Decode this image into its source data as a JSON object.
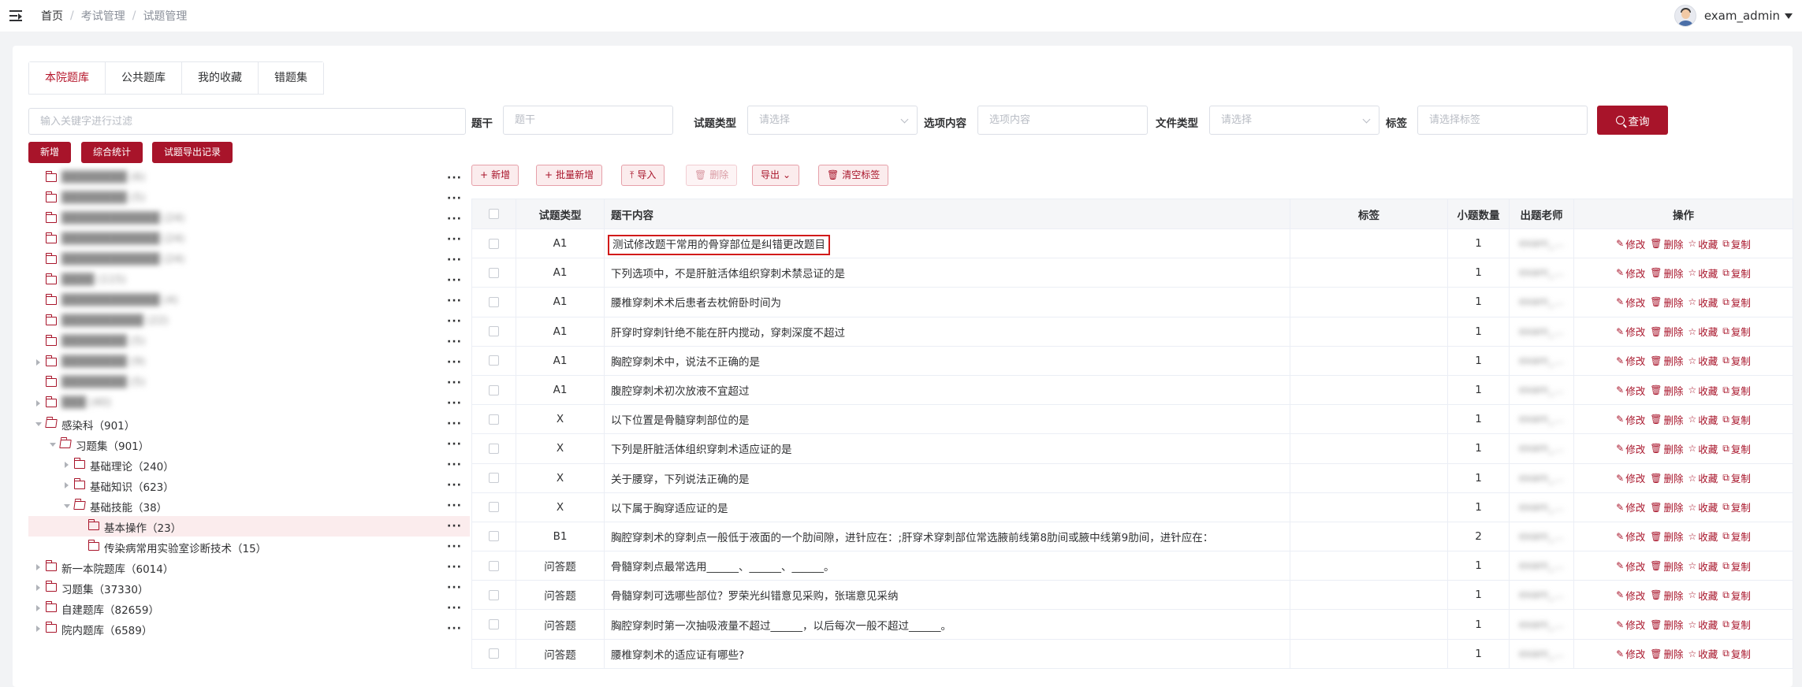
{
  "breadcrumb": {
    "home": "首页",
    "items": [
      "考试管理",
      "试题管理"
    ]
  },
  "user": {
    "name": "exam_admin"
  },
  "tabs": [
    "本院题库",
    "公共题库",
    "我的收藏",
    "错题集"
  ],
  "left": {
    "search_placeholder": "输入关键字进行过滤",
    "buttons": [
      "新增",
      "综合统计",
      "试题导出记录"
    ]
  },
  "tree": [
    {
      "label": "████████ (6)",
      "blurred": true
    },
    {
      "label": "████████ (5)",
      "blurred": true
    },
    {
      "label": "████████████ (24)",
      "blurred": true
    },
    {
      "label": "████████████ (24)",
      "blurred": true
    },
    {
      "label": "████████████ (24)",
      "blurred": true
    },
    {
      "label": "████ (115)",
      "blurred": true
    },
    {
      "label": "████████████ (4)",
      "blurred": true
    },
    {
      "label": "██████████ (22)",
      "blurred": true
    },
    {
      "label": "████████ (5)",
      "blurred": true
    },
    {
      "label": "████████ (9)",
      "blurred": true
    },
    {
      "label": "████████ (5)",
      "blurred": true
    },
    {
      "label": "███ (40)",
      "blurred": true
    },
    {
      "label": "感染科（901）",
      "blurred": false
    },
    {
      "label": "习题集（901）",
      "blurred": false
    },
    {
      "label": "基础理论（240）",
      "blurred": false
    },
    {
      "label": "基础知识（623）",
      "blurred": false
    },
    {
      "label": "基础技能（38）",
      "blurred": false
    },
    {
      "label": "基本操作（23）",
      "blurred": false
    },
    {
      "label": "传染病常用实验室诊断技术（15）",
      "blurred": false
    },
    {
      "label": "新一本院题库（6014）",
      "blurred": false
    },
    {
      "label": "习题集（37330）",
      "blurred": false
    },
    {
      "label": "自建题库（82659）",
      "blurred": false
    },
    {
      "label": "院内题库（6589）",
      "blurred": false
    }
  ],
  "filters": {
    "stem_label": "题干",
    "stem_placeholder": "题干",
    "type_label": "试题类型",
    "type_placeholder": "请选择",
    "option_label": "选项内容",
    "option_placeholder": "选项内容",
    "file_label": "文件类型",
    "file_placeholder": "请选择",
    "tag_label": "标签",
    "tag_placeholder": "请选择标签",
    "query_label": "查询"
  },
  "toolbar": {
    "add": "新增",
    "batch_add": "批量新增",
    "import": "导入",
    "delete": "删除",
    "export": "导出",
    "clear_tags": "清空标签"
  },
  "table": {
    "headers": [
      "试题类型",
      "题干内容",
      "标签",
      "小题数量",
      "出题老师",
      "操作"
    ],
    "ops": [
      "修改",
      "删除",
      "收藏",
      "复制"
    ],
    "rows": [
      {
        "type": "A1",
        "content": "测试修改题干常用的骨穿部位是纠错更改题目",
        "tag": "",
        "count": "1",
        "teacher": "exam_..."
      },
      {
        "type": "A1",
        "content": "下列选项中，不是肝脏活体组织穿刺术禁忌证的是",
        "tag": "",
        "count": "1",
        "teacher": "exam_..."
      },
      {
        "type": "A1",
        "content": "腰椎穿刺术术后患者去枕俯卧时间为",
        "tag": "",
        "count": "1",
        "teacher": "exam_..."
      },
      {
        "type": "A1",
        "content": "肝穿时穿刺针绝不能在肝内搅动，穿刺深度不超过",
        "tag": "",
        "count": "1",
        "teacher": "exam_..."
      },
      {
        "type": "A1",
        "content": "胸腔穿刺术中，说法不正确的是",
        "tag": "",
        "count": "1",
        "teacher": "exam_..."
      },
      {
        "type": "A1",
        "content": "腹腔穿刺术初次放液不宜超过",
        "tag": "",
        "count": "1",
        "teacher": "exam_..."
      },
      {
        "type": "X",
        "content": "以下位置是骨髓穿刺部位的是",
        "tag": "",
        "count": "1",
        "teacher": "exam_..."
      },
      {
        "type": "X",
        "content": "下列是肝脏活体组织穿刺术适应证的是",
        "tag": "",
        "count": "1",
        "teacher": "exam_..."
      },
      {
        "type": "X",
        "content": "关于腰穿，下列说法正确的是",
        "tag": "",
        "count": "1",
        "teacher": "exam_..."
      },
      {
        "type": "X",
        "content": "以下属于胸穿适应证的是",
        "tag": "",
        "count": "1",
        "teacher": "exam_..."
      },
      {
        "type": "B1",
        "content": "胸腔穿刺术的穿刺点一般低于液面的一个肋间隙，进针应在：;肝穿术穿刺部位常选腋前线第8肋间或腋中线第9肋间，进针应在：",
        "tag": "",
        "count": "2",
        "teacher": "exam_..."
      },
      {
        "type": "问答题",
        "content": "骨髓穿刺点最常选用______、______、______。",
        "tag": "",
        "count": "1",
        "teacher": "exam_..."
      },
      {
        "type": "问答题",
        "content": "骨髓穿刺可选哪些部位？罗荣光纠错意见采购，张瑞意见采纳",
        "tag": "",
        "count": "1",
        "teacher": "exam_..."
      },
      {
        "type": "问答题",
        "content": "胸腔穿刺时第一次抽吸液量不超过______，以后每次一般不超过______。",
        "tag": "",
        "count": "1",
        "teacher": "exam_..."
      },
      {
        "type": "问答题",
        "content": "腰椎穿刺术的适应证有哪些?",
        "tag": "",
        "count": "1",
        "teacher": "exam_..."
      }
    ]
  },
  "colors": {
    "accent": "#a8142a",
    "highlight_box": "#d11a1a"
  }
}
